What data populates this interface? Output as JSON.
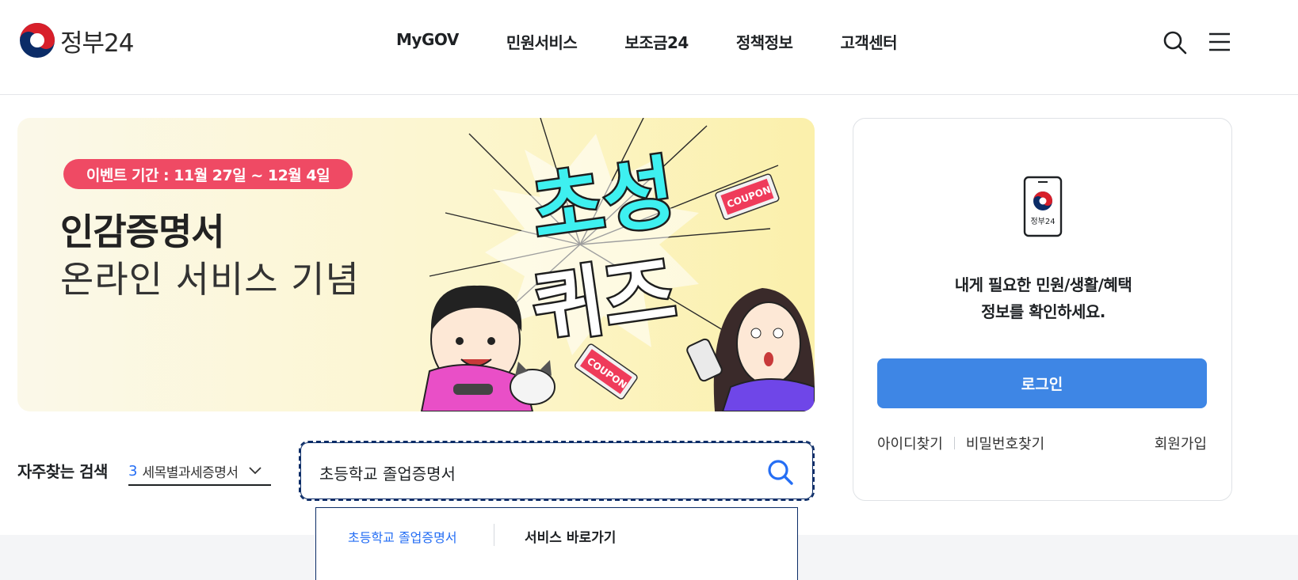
{
  "header": {
    "logo_text": "정부24",
    "nav": [
      "MyGOV",
      "민원서비스",
      "보조금24",
      "정책정보",
      "고객센터"
    ],
    "search_icon": "search-icon",
    "menu_icon": "hamburger-menu-icon"
  },
  "banner": {
    "event_period": "이벤트 기간 : 11월 27일 ~ 12월 4일",
    "title": "인감증명서",
    "subtitle": "온라인 서비스 기념",
    "quiz_line1": "초성",
    "quiz_line2": "퀴즈",
    "coupon_label": "COUPON",
    "colors": {
      "pill": "#ef4a64",
      "quiz_text": "#3ef0f0"
    }
  },
  "frequent_search": {
    "label": "자주찾는 검색",
    "rank": "3",
    "term": "세목별과세증명서"
  },
  "search": {
    "value": "초등학교 졸업증명서",
    "button_icon": "search-icon"
  },
  "suggestion": {
    "item": "초등학교 졸업증명서",
    "title": "서비스 바로가기"
  },
  "login_card": {
    "phone_label": "정부24",
    "message_line1": "내게 필요한 민원/생활/혜택",
    "message_line2": "정보를 확인하세요.",
    "login_button": "로그인",
    "find_id": "아이디찾기",
    "find_password": "비밀번호찾기",
    "signup": "회원가입",
    "accent": "#3e86e5"
  }
}
